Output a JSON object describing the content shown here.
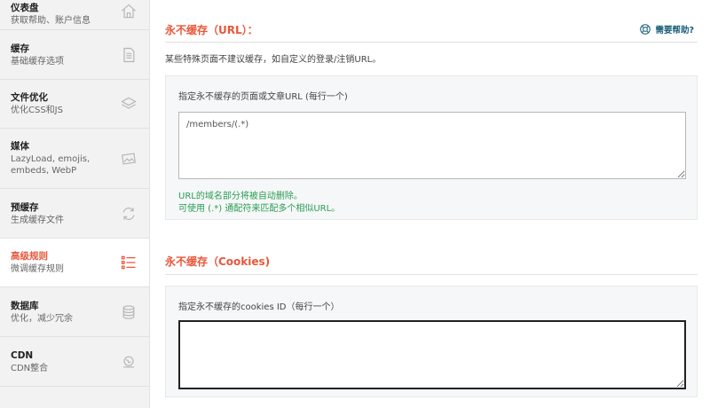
{
  "sidebar": {
    "items": [
      {
        "title": "仪表盘",
        "subtitle": "获取帮助、账户信息",
        "icon": "home-icon"
      },
      {
        "title": "缓存",
        "subtitle": "基础缓存选项",
        "icon": "file-icon"
      },
      {
        "title": "文件优化",
        "subtitle": "优化CSS和JS",
        "icon": "layers-icon"
      },
      {
        "title": "媒体",
        "subtitle": "LazyLoad, emojis, embeds, WebP",
        "icon": "image-icon"
      },
      {
        "title": "预缓存",
        "subtitle": "生成缓存文件",
        "icon": "refresh-icon"
      },
      {
        "title": "高级规则",
        "subtitle": "微调缓存规则",
        "icon": "list-icon",
        "active": true
      },
      {
        "title": "数据库",
        "subtitle": "优化，减少冗余",
        "icon": "database-icon"
      },
      {
        "title": "CDN",
        "subtitle": "CDN整合",
        "icon": "cdn-icon"
      }
    ]
  },
  "main": {
    "section_url": {
      "title": "永不缓存（URL）：",
      "help_label": "需要帮助?",
      "description": "某些特殊页面不建议缓存，如自定义的登录/注销URL。",
      "field_label": "指定永不缓存的页面或文章URL (每行一个)",
      "field_value": "/members/(.*)",
      "note_1": "URL的域名部分将被自动删除。",
      "note_2": "可使用 (.*) 通配符来匹配多个相似URL。"
    },
    "section_cookies": {
      "title": "永不缓存（Cookies)",
      "field_label": "指定永不缓存的cookies ID（每行一个）",
      "field_value": ""
    }
  },
  "colors": {
    "accent": "#e8573a",
    "note_green": "#2a9d54",
    "help_blue": "#1b5f7a",
    "sidebar_bg": "#f2f2f2"
  }
}
